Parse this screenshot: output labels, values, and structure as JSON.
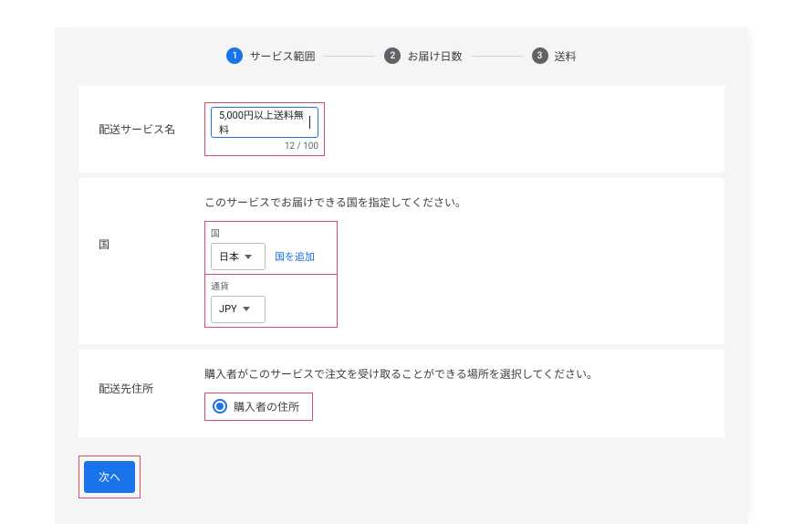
{
  "stepper": {
    "steps": [
      {
        "num": "1",
        "label": "サービス範囲",
        "active": true
      },
      {
        "num": "2",
        "label": "お届け日数",
        "active": false
      },
      {
        "num": "3",
        "label": "送料",
        "active": false
      }
    ]
  },
  "sections": {
    "service_name": {
      "label": "配送サービス名",
      "input_value": "5,000円以上送料無料",
      "char_count": "12 / 100"
    },
    "country": {
      "label": "国",
      "hint": "このサービスでお届けできる国を指定してください。",
      "country_field_label": "国",
      "country_value": "日本",
      "add_country_link": "国を追加",
      "currency_field_label": "通貨",
      "currency_value": "JPY"
    },
    "destination": {
      "label": "配送先住所",
      "hint": "購入者がこのサービスで注文を受け取ることができる場所を選択してください。",
      "radio_label": "購入者の住所"
    }
  },
  "footer": {
    "next_button": "次へ"
  }
}
